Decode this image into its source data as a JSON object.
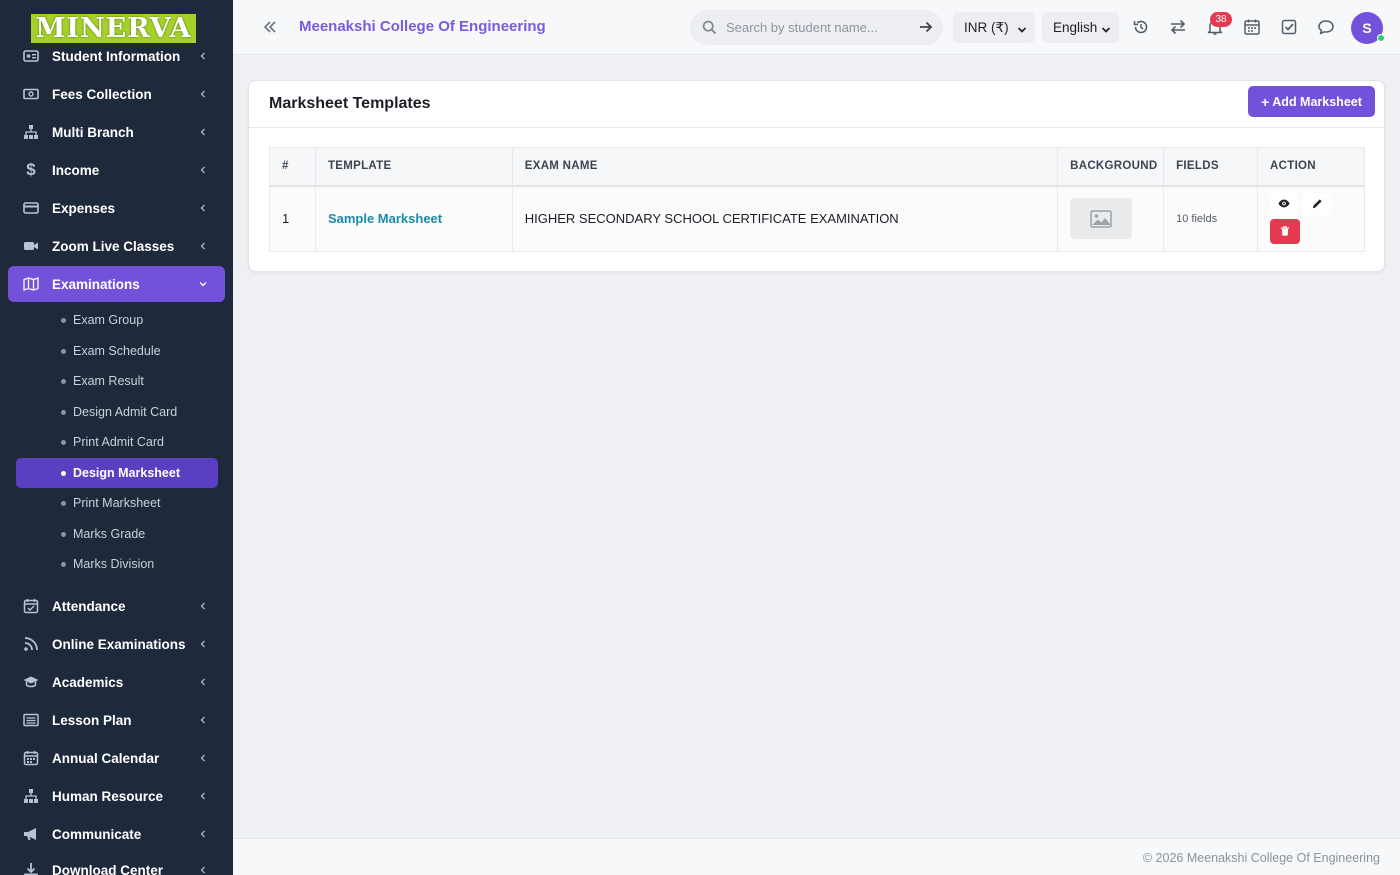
{
  "brand": {
    "logo_text": "MINERVA"
  },
  "sidebar": {
    "items": [
      {
        "label": "Student Information",
        "icon": "id-card-icon"
      },
      {
        "label": "Fees Collection",
        "icon": "money-icon"
      },
      {
        "label": "Multi Branch",
        "icon": "sitemap-icon"
      },
      {
        "label": "Income",
        "icon": "dollar-icon"
      },
      {
        "label": "Expenses",
        "icon": "credit-card-icon"
      },
      {
        "label": "Zoom Live Classes",
        "icon": "video-icon"
      },
      {
        "label": "Examinations",
        "icon": "map-icon",
        "active": true
      },
      {
        "label": "Attendance",
        "icon": "calendar-check-icon"
      },
      {
        "label": "Online Examinations",
        "icon": "rss-icon"
      },
      {
        "label": "Academics",
        "icon": "graduation-cap-icon"
      },
      {
        "label": "Lesson Plan",
        "icon": "list-icon"
      },
      {
        "label": "Annual Calendar",
        "icon": "calendar-icon"
      },
      {
        "label": "Human Resource",
        "icon": "sitemap-icon"
      },
      {
        "label": "Communicate",
        "icon": "bullhorn-icon"
      },
      {
        "label": "Download Center",
        "icon": "download-icon"
      }
    ],
    "exam_sub": [
      {
        "label": "Exam Group"
      },
      {
        "label": "Exam Schedule"
      },
      {
        "label": "Exam Result"
      },
      {
        "label": "Design Admit Card"
      },
      {
        "label": "Print Admit Card"
      },
      {
        "label": "Design Marksheet",
        "active": true
      },
      {
        "label": "Print Marksheet"
      },
      {
        "label": "Marks Grade"
      },
      {
        "label": "Marks Division"
      }
    ]
  },
  "header": {
    "college_name": "Meenakshi College Of Engineering",
    "search_placeholder": "Search by student name...",
    "currency": "INR (₹)",
    "language": "English",
    "notification_count": "38",
    "avatar_initial": "S"
  },
  "card": {
    "title": "Marksheet Templates",
    "add_button": "Add Marksheet",
    "columns": [
      "#",
      "TEMPLATE",
      "EXAM NAME",
      "BACKGROUND",
      "FIELDS",
      "ACTION"
    ],
    "rows": [
      {
        "num": "1",
        "template": "Sample Marksheet",
        "exam": "HIGHER SECONDARY SCHOOL CERTIFICATE EXAMINATION",
        "fields": "10 fields"
      }
    ]
  },
  "footer": {
    "text": "© 2026 Meenakshi College Of Engineering"
  },
  "colors": {
    "accent": "#7352db",
    "sidebar_bg": "#1e2a3b",
    "danger": "#e53950",
    "link": "#1a8aa6"
  }
}
